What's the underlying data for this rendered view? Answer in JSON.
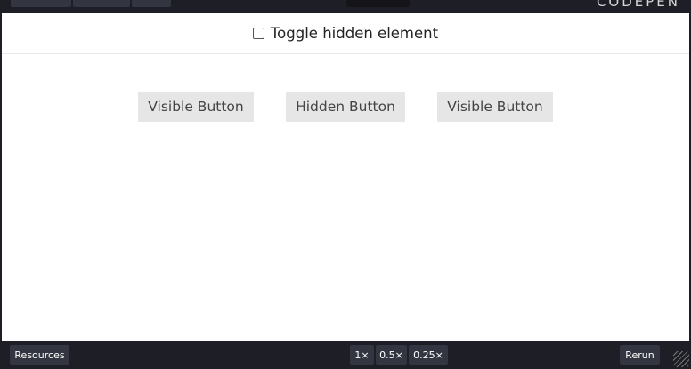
{
  "window": {
    "logo_text": "CODEPEN"
  },
  "result": {
    "toggle_label": "Toggle hidden element",
    "toggle_checked": false,
    "buttons": [
      {
        "label": "Visible Button"
      },
      {
        "label": "Hidden Button"
      },
      {
        "label": "Visible Button"
      }
    ]
  },
  "bottombar": {
    "resources_label": "Resources",
    "zoom_options": [
      "1×",
      "0.5×",
      "0.25×"
    ],
    "rerun_label": "Rerun"
  },
  "colors": {
    "chrome_background": "#1e1f26",
    "chrome_button": "#333541",
    "demo_button": "#e6e6e6"
  }
}
